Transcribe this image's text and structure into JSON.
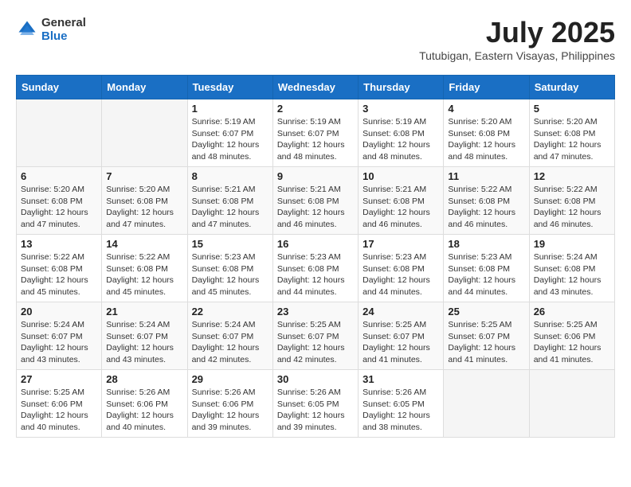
{
  "header": {
    "logo_general": "General",
    "logo_blue": "Blue",
    "month_year": "July 2025",
    "location": "Tutubigan, Eastern Visayas, Philippines"
  },
  "days_of_week": [
    "Sunday",
    "Monday",
    "Tuesday",
    "Wednesday",
    "Thursday",
    "Friday",
    "Saturday"
  ],
  "weeks": [
    [
      {
        "day": "",
        "info": ""
      },
      {
        "day": "",
        "info": ""
      },
      {
        "day": "1",
        "info": "Sunrise: 5:19 AM\nSunset: 6:07 PM\nDaylight: 12 hours and 48 minutes."
      },
      {
        "day": "2",
        "info": "Sunrise: 5:19 AM\nSunset: 6:07 PM\nDaylight: 12 hours and 48 minutes."
      },
      {
        "day": "3",
        "info": "Sunrise: 5:19 AM\nSunset: 6:08 PM\nDaylight: 12 hours and 48 minutes."
      },
      {
        "day": "4",
        "info": "Sunrise: 5:20 AM\nSunset: 6:08 PM\nDaylight: 12 hours and 48 minutes."
      },
      {
        "day": "5",
        "info": "Sunrise: 5:20 AM\nSunset: 6:08 PM\nDaylight: 12 hours and 47 minutes."
      }
    ],
    [
      {
        "day": "6",
        "info": "Sunrise: 5:20 AM\nSunset: 6:08 PM\nDaylight: 12 hours and 47 minutes."
      },
      {
        "day": "7",
        "info": "Sunrise: 5:20 AM\nSunset: 6:08 PM\nDaylight: 12 hours and 47 minutes."
      },
      {
        "day": "8",
        "info": "Sunrise: 5:21 AM\nSunset: 6:08 PM\nDaylight: 12 hours and 47 minutes."
      },
      {
        "day": "9",
        "info": "Sunrise: 5:21 AM\nSunset: 6:08 PM\nDaylight: 12 hours and 46 minutes."
      },
      {
        "day": "10",
        "info": "Sunrise: 5:21 AM\nSunset: 6:08 PM\nDaylight: 12 hours and 46 minutes."
      },
      {
        "day": "11",
        "info": "Sunrise: 5:22 AM\nSunset: 6:08 PM\nDaylight: 12 hours and 46 minutes."
      },
      {
        "day": "12",
        "info": "Sunrise: 5:22 AM\nSunset: 6:08 PM\nDaylight: 12 hours and 46 minutes."
      }
    ],
    [
      {
        "day": "13",
        "info": "Sunrise: 5:22 AM\nSunset: 6:08 PM\nDaylight: 12 hours and 45 minutes."
      },
      {
        "day": "14",
        "info": "Sunrise: 5:22 AM\nSunset: 6:08 PM\nDaylight: 12 hours and 45 minutes."
      },
      {
        "day": "15",
        "info": "Sunrise: 5:23 AM\nSunset: 6:08 PM\nDaylight: 12 hours and 45 minutes."
      },
      {
        "day": "16",
        "info": "Sunrise: 5:23 AM\nSunset: 6:08 PM\nDaylight: 12 hours and 44 minutes."
      },
      {
        "day": "17",
        "info": "Sunrise: 5:23 AM\nSunset: 6:08 PM\nDaylight: 12 hours and 44 minutes."
      },
      {
        "day": "18",
        "info": "Sunrise: 5:23 AM\nSunset: 6:08 PM\nDaylight: 12 hours and 44 minutes."
      },
      {
        "day": "19",
        "info": "Sunrise: 5:24 AM\nSunset: 6:08 PM\nDaylight: 12 hours and 43 minutes."
      }
    ],
    [
      {
        "day": "20",
        "info": "Sunrise: 5:24 AM\nSunset: 6:07 PM\nDaylight: 12 hours and 43 minutes."
      },
      {
        "day": "21",
        "info": "Sunrise: 5:24 AM\nSunset: 6:07 PM\nDaylight: 12 hours and 43 minutes."
      },
      {
        "day": "22",
        "info": "Sunrise: 5:24 AM\nSunset: 6:07 PM\nDaylight: 12 hours and 42 minutes."
      },
      {
        "day": "23",
        "info": "Sunrise: 5:25 AM\nSunset: 6:07 PM\nDaylight: 12 hours and 42 minutes."
      },
      {
        "day": "24",
        "info": "Sunrise: 5:25 AM\nSunset: 6:07 PM\nDaylight: 12 hours and 41 minutes."
      },
      {
        "day": "25",
        "info": "Sunrise: 5:25 AM\nSunset: 6:07 PM\nDaylight: 12 hours and 41 minutes."
      },
      {
        "day": "26",
        "info": "Sunrise: 5:25 AM\nSunset: 6:06 PM\nDaylight: 12 hours and 41 minutes."
      }
    ],
    [
      {
        "day": "27",
        "info": "Sunrise: 5:25 AM\nSunset: 6:06 PM\nDaylight: 12 hours and 40 minutes."
      },
      {
        "day": "28",
        "info": "Sunrise: 5:26 AM\nSunset: 6:06 PM\nDaylight: 12 hours and 40 minutes."
      },
      {
        "day": "29",
        "info": "Sunrise: 5:26 AM\nSunset: 6:06 PM\nDaylight: 12 hours and 39 minutes."
      },
      {
        "day": "30",
        "info": "Sunrise: 5:26 AM\nSunset: 6:05 PM\nDaylight: 12 hours and 39 minutes."
      },
      {
        "day": "31",
        "info": "Sunrise: 5:26 AM\nSunset: 6:05 PM\nDaylight: 12 hours and 38 minutes."
      },
      {
        "day": "",
        "info": ""
      },
      {
        "day": "",
        "info": ""
      }
    ]
  ]
}
